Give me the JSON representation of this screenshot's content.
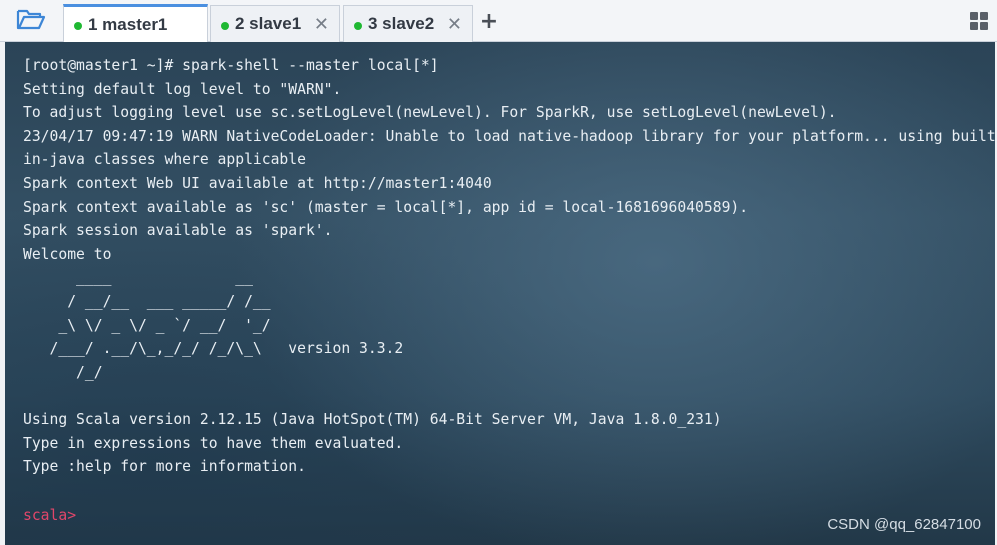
{
  "tabs": [
    {
      "label": "1 master1",
      "active": true,
      "status_color": "#1fb832"
    },
    {
      "label": "2 slave1",
      "active": false,
      "status_color": "#1fb832"
    },
    {
      "label": "3 slave2",
      "active": false,
      "status_color": "#1fb832"
    }
  ],
  "toolbar": {
    "folder_icon": "folder-open-icon",
    "new_tab_glyph": "+",
    "layout_icon": "grid-layout-icon",
    "close_glyph": "✕"
  },
  "terminal": {
    "lines": [
      "[root@master1 ~]# spark-shell --master local[*]",
      "Setting default log level to \"WARN\".",
      "To adjust logging level use sc.setLogLevel(newLevel). For SparkR, use setLogLevel(newLevel).",
      "23/04/17 09:47:19 WARN NativeCodeLoader: Unable to load native-hadoop library for your platform... using built",
      "in-java classes where applicable",
      "Spark context Web UI available at http://master1:4040",
      "Spark context available as 'sc' (master = local[*], app id = local-1681696040589).",
      "Spark session available as 'spark'.",
      "Welcome to",
      "      ____              __",
      "     / __/__  ___ _____/ /__",
      "    _\\ \\/ _ \\/ _ `/ __/  '_/",
      "   /___/ .__/\\_,_/_/ /_/\\_\\   version 3.3.2",
      "      /_/",
      "",
      "Using Scala version 2.12.15 (Java HotSpot(TM) 64-Bit Server VM, Java 1.8.0_231)",
      "Type in expressions to have them evaluated.",
      "Type :help for more information."
    ],
    "prompt": "scala>",
    "prompt_color": "#e0466a"
  },
  "watermark": "CSDN @qq_62847100"
}
